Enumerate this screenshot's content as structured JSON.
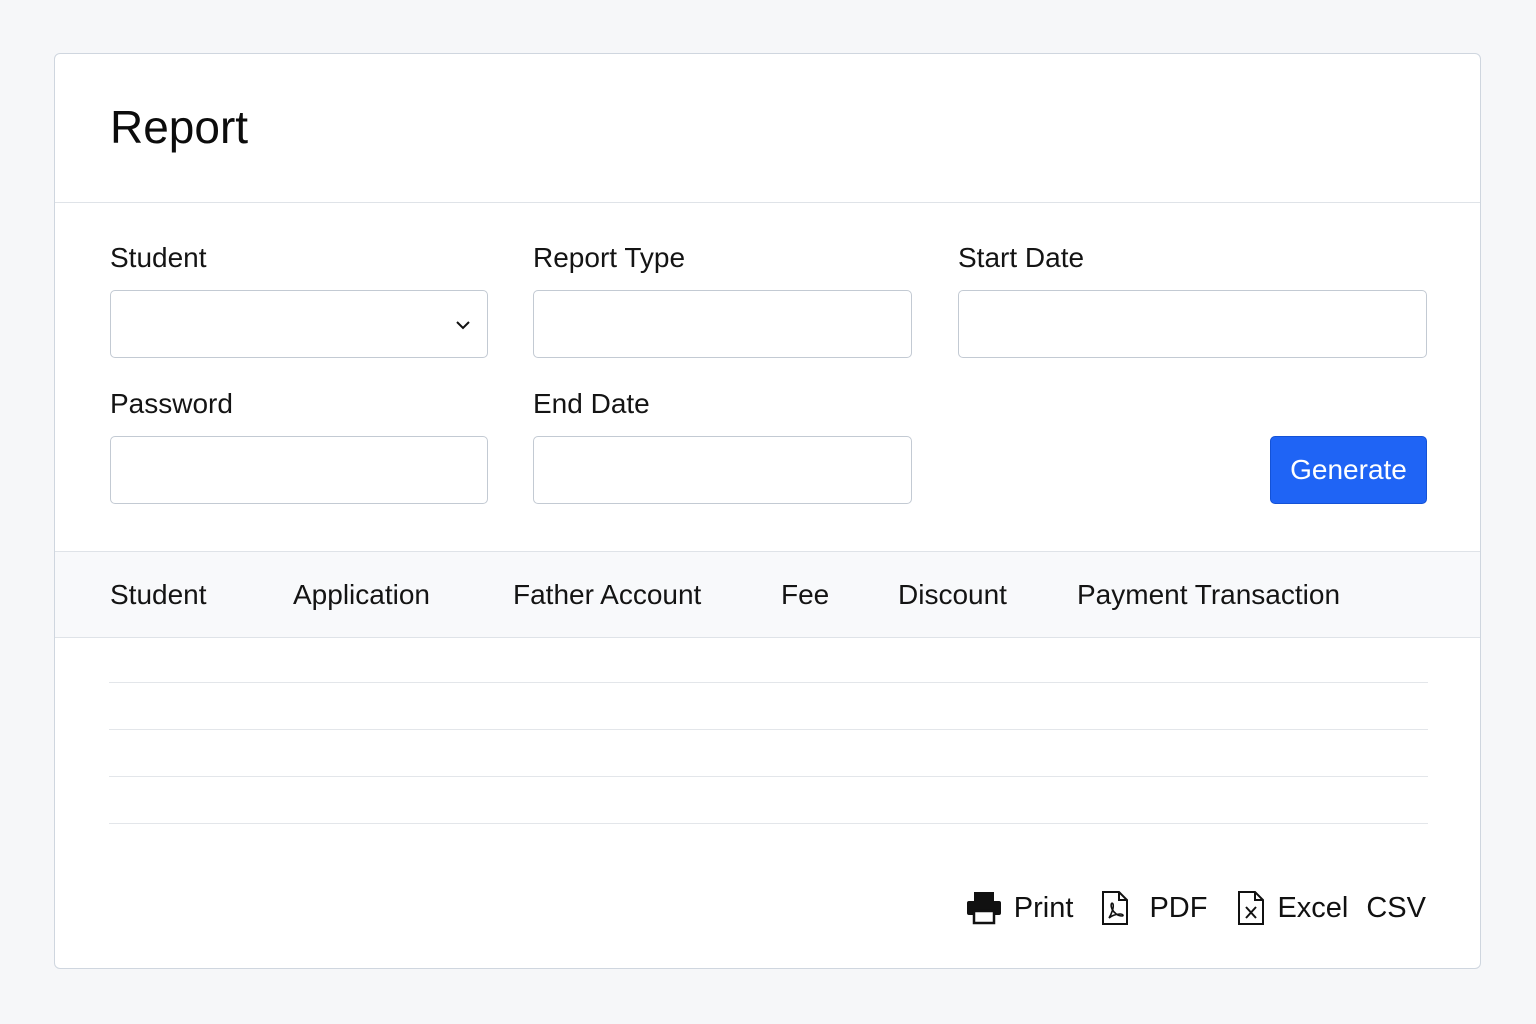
{
  "header": {
    "title": "Report"
  },
  "form": {
    "student": {
      "label": "Student",
      "value": ""
    },
    "report_type": {
      "label": "Report Type",
      "value": ""
    },
    "start_date": {
      "label": "Start Date",
      "value": ""
    },
    "password": {
      "label": "Password",
      "value": ""
    },
    "end_date": {
      "label": "End Date",
      "value": ""
    },
    "generate_label": "Generate"
  },
  "table": {
    "columns": [
      "Student",
      "Application",
      "Father Account",
      "Fee",
      "Discount",
      "Payment Transaction"
    ],
    "rows": []
  },
  "actions": {
    "print": "Print",
    "pdf": "PDF",
    "excel": "Excel",
    "csv": "CSV"
  },
  "colors": {
    "primary": "#1f64f5",
    "border": "#c3cad3",
    "background": "#f6f7f9"
  },
  "icons": [
    "chevron-down-icon",
    "printer-icon",
    "pdf-file-icon",
    "excel-file-icon"
  ]
}
